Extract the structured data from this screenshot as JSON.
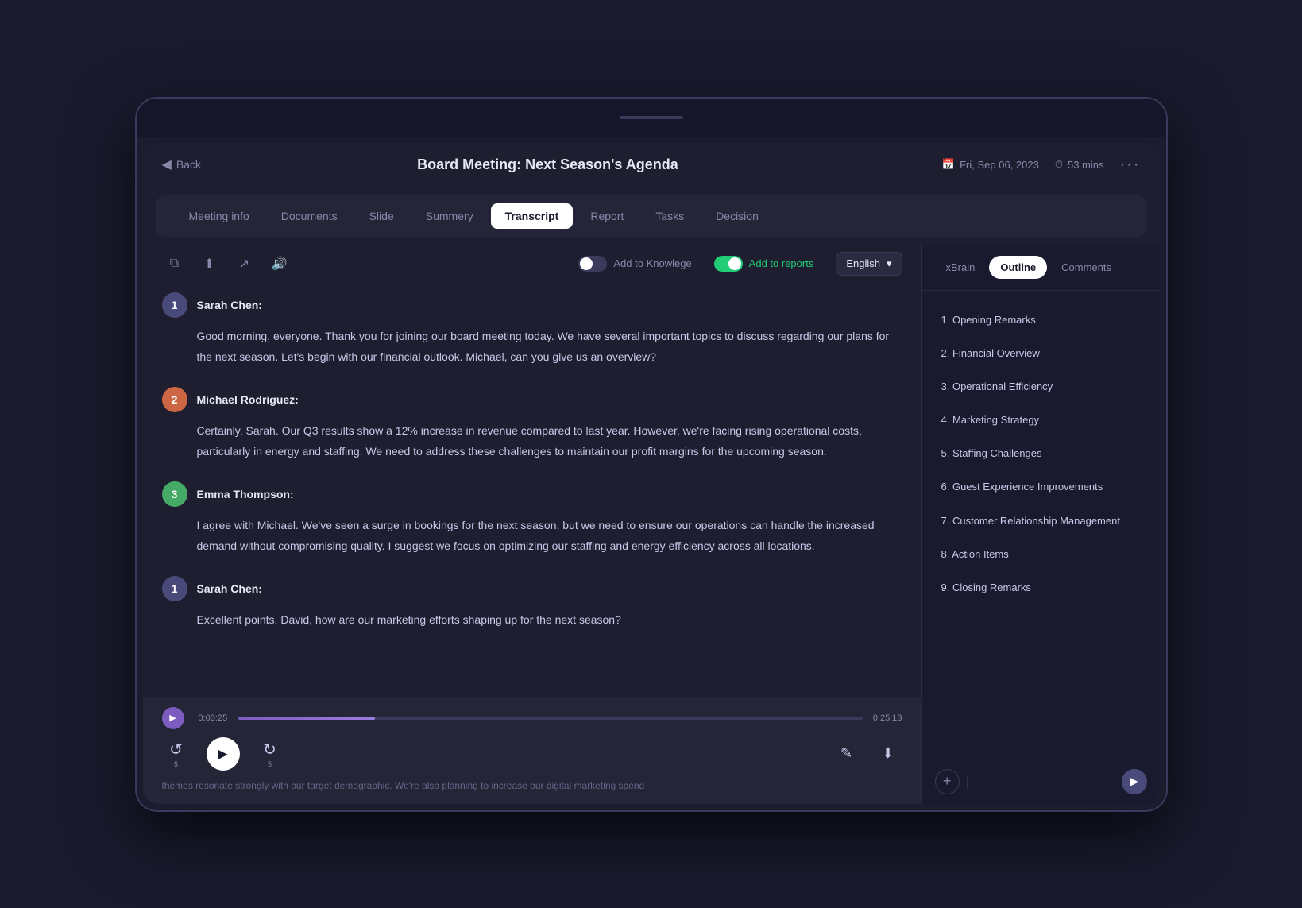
{
  "device": {
    "topBarDot": ""
  },
  "header": {
    "back_label": "Back",
    "title": "Board Meeting: Next Season's Agenda",
    "date_icon": "📅",
    "date": "Fri, Sep 06, 2023",
    "time_icon": "⏱",
    "duration": "53 mins",
    "more": "···"
  },
  "tabs": [
    {
      "id": "meeting-info",
      "label": "Meeting info",
      "active": false
    },
    {
      "id": "documents",
      "label": "Documents",
      "active": false
    },
    {
      "id": "slide",
      "label": "Slide",
      "active": false
    },
    {
      "id": "summery",
      "label": "Summery",
      "active": false
    },
    {
      "id": "transcript",
      "label": "Transcript",
      "active": true
    },
    {
      "id": "report",
      "label": "Report",
      "active": false
    },
    {
      "id": "tasks",
      "label": "Tasks",
      "active": false
    },
    {
      "id": "decision",
      "label": "Decision",
      "active": false
    }
  ],
  "toolbar": {
    "copy_icon": "⧉",
    "upload_icon": "↑",
    "share_icon": "⤴",
    "speaker_icon": "🔊",
    "knowledge_toggle": "off",
    "knowledge_label": "Add to Knowlege",
    "reports_toggle": "on",
    "reports_label": "Add to reports",
    "language": "English"
  },
  "messages": [
    {
      "id": 1,
      "avatar_num": "1",
      "avatar_color": "avatar-1",
      "speaker": "Sarah Chen:",
      "text": "Good morning, everyone. Thank you for joining our board meeting today. We have several important topics to discuss regarding our plans for the next season. Let's begin with our financial outlook. Michael, can you give us an overview?"
    },
    {
      "id": 2,
      "avatar_num": "2",
      "avatar_color": "avatar-2",
      "speaker": "Michael Rodriguez:",
      "text": "Certainly, Sarah. Our Q3 results show a 12% increase in revenue compared to last year. However, we're facing rising operational costs, particularly in energy and staffing. We need to address these challenges to maintain our profit margins for the upcoming season."
    },
    {
      "id": 3,
      "avatar_num": "3",
      "avatar_color": "avatar-3",
      "speaker": "Emma Thompson:",
      "text": "I agree with Michael. We've seen a surge in bookings for the next season, but we need to ensure our operations can handle the increased demand without compromising quality. I suggest we focus on optimizing our staffing and energy efficiency across all locations."
    },
    {
      "id": 4,
      "avatar_num": "1",
      "avatar_color": "avatar-1",
      "speaker": "Sarah Chen:",
      "text": "Excellent points. David, how are our marketing efforts shaping up for the next season?"
    }
  ],
  "audio": {
    "current_time": "0:03:25",
    "total_time": "0:25:13",
    "progress_percent": 22,
    "rewind_label": "5",
    "forward_label": "5"
  },
  "overflow_text": "themes resonate strongly with our target demographic. We're also planning to increase our digital marketing spend",
  "right_panel": {
    "tabs": [
      {
        "id": "xbrain",
        "label": "xBrain",
        "active": false
      },
      {
        "id": "outline",
        "label": "Outline",
        "active": true
      },
      {
        "id": "comments",
        "label": "Comments",
        "active": false
      }
    ],
    "outline_items": [
      {
        "id": 1,
        "label": "1. Opening Remarks"
      },
      {
        "id": 2,
        "label": "2. Financial Overview"
      },
      {
        "id": 3,
        "label": "3. Operational Efficiency"
      },
      {
        "id": 4,
        "label": "4. Marketing Strategy"
      },
      {
        "id": 5,
        "label": "5. Staffing Challenges"
      },
      {
        "id": 6,
        "label": "6. Guest Experience Improvements"
      },
      {
        "id": 7,
        "label": "7. Customer Relationship Management"
      },
      {
        "id": 8,
        "label": "8. Action Items"
      },
      {
        "id": 9,
        "label": "9. Closing Remarks"
      }
    ],
    "comment_placeholder": "",
    "add_icon": "+",
    "send_icon": "▶"
  }
}
